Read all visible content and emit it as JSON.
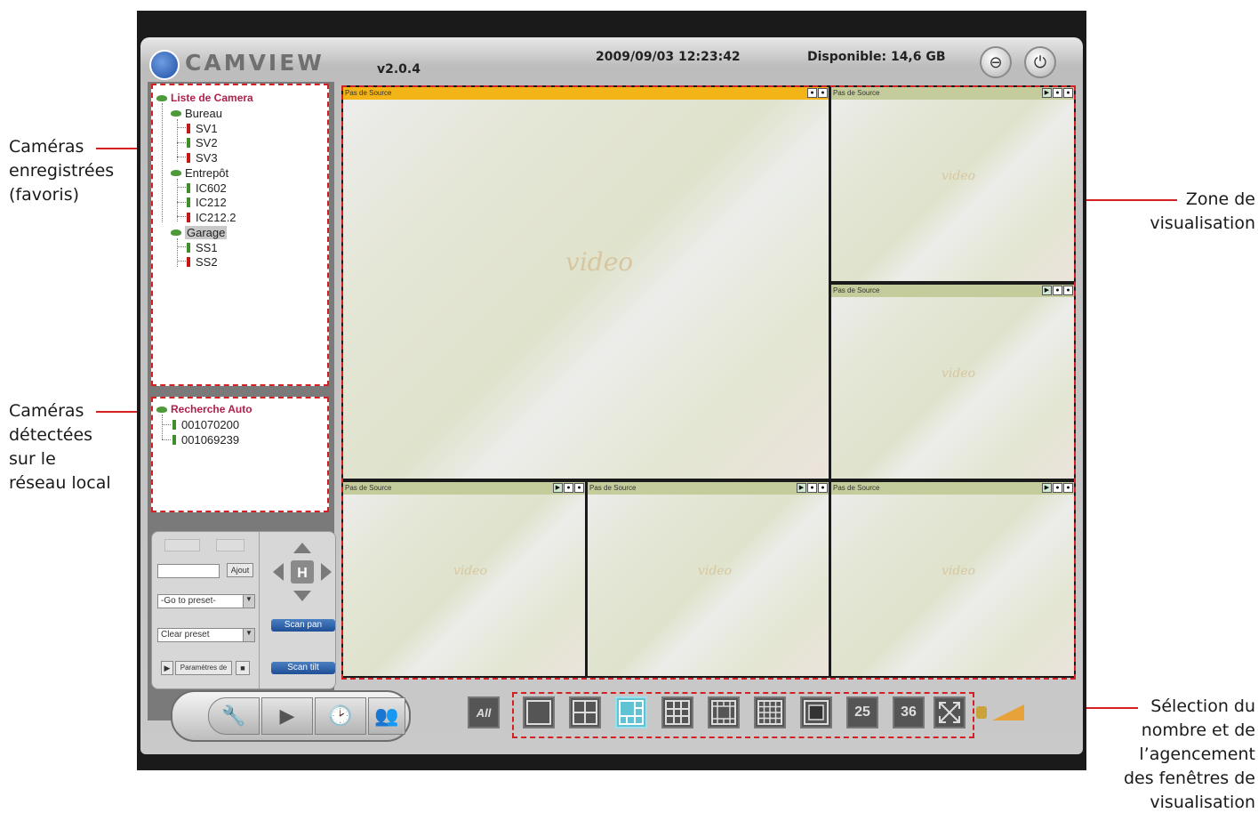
{
  "app": {
    "name": "CAMVIEW",
    "version": "v2.0.4",
    "datetime": "2009/09/03 12:23:42",
    "disk": "Disponible: 14,6 GB",
    "accent_color": "#d42020"
  },
  "annotations": {
    "registered": [
      "Caméras",
      "enregistrées",
      "(favoris)"
    ],
    "detected": [
      "Caméras",
      "détectées",
      "sur le",
      "réseau local"
    ],
    "view_zone": [
      "Zone de",
      "visualisation"
    ],
    "layout": [
      "Sélection du",
      "nombre et de",
      "l’agencement",
      "des fenêtres de",
      "visualisation"
    ]
  },
  "camera_list": {
    "root": "Liste de Camera",
    "groups": [
      {
        "name": "Bureau",
        "items": [
          "SV1",
          "SV2",
          "SV3"
        ]
      },
      {
        "name": "Entrepôt",
        "items": [
          "IC602",
          "IC212",
          "IC212.2"
        ]
      },
      {
        "name": "Garage",
        "items": [
          "SS1",
          "SS2"
        ]
      }
    ]
  },
  "auto_search": {
    "root": "Recherche Auto",
    "items": [
      "001070200",
      "001069239"
    ]
  },
  "ptz": {
    "add_label": "Ajout",
    "goto_preset": "-Go to preset-",
    "clear_preset": "Clear preset",
    "params_label": "Paramètres de",
    "scan_pan": "Scan pan",
    "scan_tilt": "Scan tilt"
  },
  "tiles": {
    "no_source": "Pas de Source",
    "watermark": "video"
  },
  "layout_buttons": {
    "all": "All",
    "b25": "25",
    "b36": "36"
  }
}
